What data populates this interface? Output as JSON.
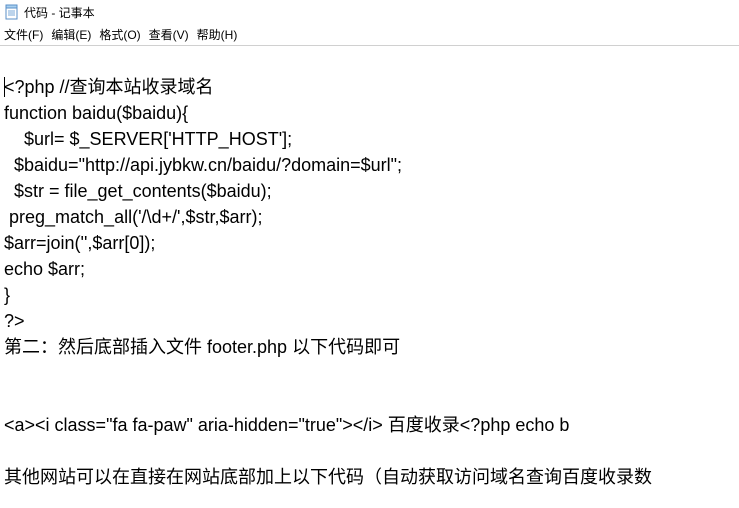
{
  "window": {
    "title": "代码 - 记事本"
  },
  "menu": {
    "file": "文件(F)",
    "edit": "编辑(E)",
    "format": "格式(O)",
    "view": "查看(V)",
    "help": "帮助(H)"
  },
  "content": {
    "l1": "<?php //查询本站收录域名",
    "l2": "function baidu($baidu){",
    "l3": "    $url= $_SERVER['HTTP_HOST'];",
    "l4": "  $baidu=\"http://api.jybkw.cn/baidu/?domain=$url\";",
    "l5": "  $str = file_get_contents($baidu);",
    "l6": " preg_match_all('/\\d+/',$str,$arr);",
    "l7": "$arr=join('',$arr[0]);",
    "l8": "echo $arr;",
    "l9": "}",
    "l10": "?>",
    "l11": "第二：然后底部插入文件 footer.php 以下代码即可",
    "l12": " ",
    "l13": " ",
    "l14": "<a><i class=\"fa fa-paw\" aria-hidden=\"true\"></i> 百度收录<?php echo b",
    "l15": " ",
    "l16": "其他网站可以在直接在网站底部加上以下代码（自动获取访问域名查询百度收录数"
  }
}
